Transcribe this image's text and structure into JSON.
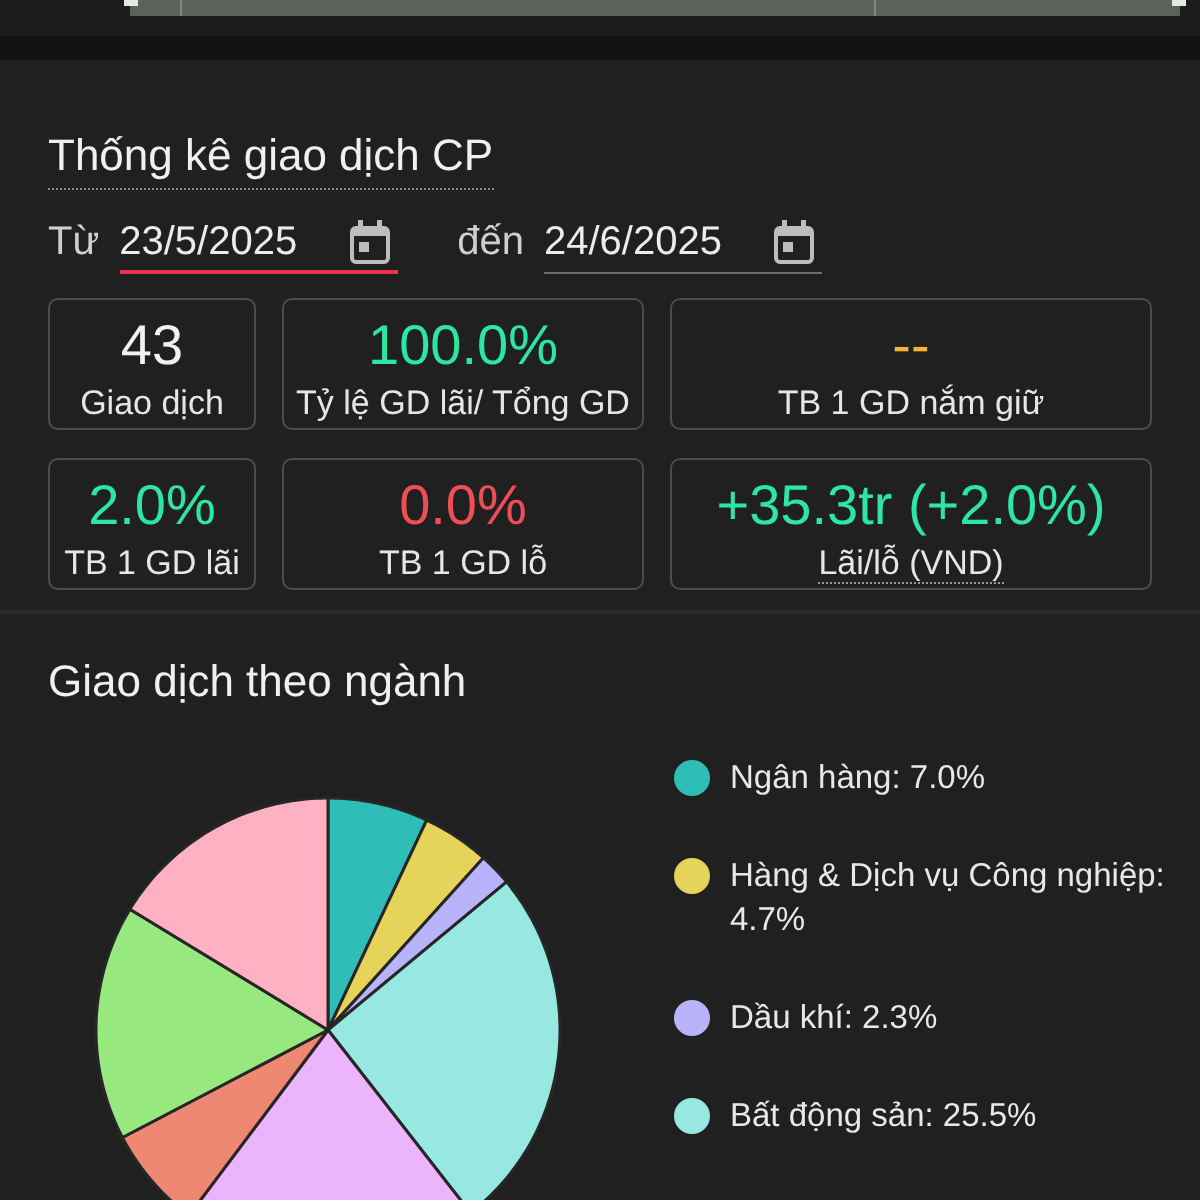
{
  "stats": {
    "title": "Thống kê giao dịch CP",
    "date_range": [
      {
        "label": "Từ",
        "value": "23/5/2025",
        "focused": true
      },
      {
        "label": "đến",
        "value": "24/6/2025",
        "focused": false
      }
    ],
    "cards": [
      {
        "value": "43",
        "label": "Giao dịch",
        "color": "#f2f2f2",
        "dotted_underline": false
      },
      {
        "value": "100.0%",
        "label": "Tỷ lệ GD lãi/ Tổng GD",
        "color": "#2ee6a4",
        "dotted_underline": false
      },
      {
        "value": "--",
        "label": "TB 1 GD nắm giữ",
        "color": "#f2b630",
        "dotted_underline": false
      },
      {
        "value": "2.0%",
        "label": "TB 1 GD lãi",
        "color": "#2ee6a4",
        "dotted_underline": false
      },
      {
        "value": "0.0%",
        "label": "TB 1 GD lỗ",
        "color": "#f04e57",
        "dotted_underline": false
      },
      {
        "value": "+35.3tr (+2.0%)",
        "label": "Lãi/lỗ (VND)",
        "color": "#2ee6a4",
        "dotted_underline": true
      }
    ]
  },
  "sectors": {
    "title": "Giao dịch theo ngành",
    "chart_data": {
      "type": "pie",
      "values": [
        7.0,
        4.7,
        2.3,
        25.5,
        20.8,
        7.1,
        16.4,
        16.3
      ],
      "colors": [
        "#2fbdb7",
        "#e6d35a",
        "#b8b3fb",
        "#98e8e2",
        "#ebb4fc",
        "#ef8872",
        "#98e880",
        "#ffb1c4"
      ]
    },
    "legend": [
      {
        "label": "Ngân hàng: 7.0%",
        "color": "#2fbdb7"
      },
      {
        "label": "Hàng & Dịch vụ Công nghiệp: 4.7%",
        "color": "#e6d35a"
      },
      {
        "label": "Dầu khí: 2.3%",
        "color": "#b8b3fb"
      },
      {
        "label": "Bất động sản: 25.5%",
        "color": "#98e8e2"
      }
    ]
  }
}
